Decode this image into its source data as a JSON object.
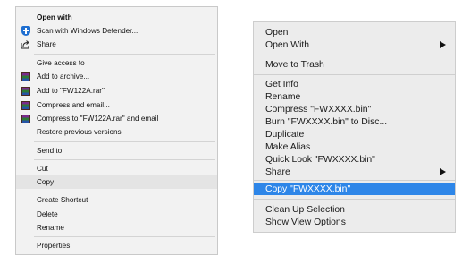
{
  "windows_menu": {
    "items": [
      {
        "label": "Open with",
        "bold": true
      },
      {
        "label": "Scan with Windows Defender...",
        "icon": "shield-icon"
      },
      {
        "label": "Share",
        "icon": "share-icon"
      },
      {
        "label": "Give access to"
      },
      {
        "label": "Add to archive...",
        "icon": "winrar-icon"
      },
      {
        "label": "Add to \"FW122A.rar\"",
        "icon": "winrar-icon"
      },
      {
        "label": "Compress and email...",
        "icon": "winrar-icon"
      },
      {
        "label": "Compress to \"FW122A.rar\" and email",
        "icon": "winrar-icon"
      },
      {
        "label": "Restore previous versions"
      },
      {
        "label": "Send to"
      },
      {
        "label": "Cut"
      },
      {
        "label": "Copy",
        "highlighted": true
      },
      {
        "label": "Create Shortcut"
      },
      {
        "label": "Delete"
      },
      {
        "label": "Rename"
      },
      {
        "label": "Properties"
      }
    ]
  },
  "mac_menu": {
    "items": [
      {
        "label": "Open"
      },
      {
        "label": "Open With",
        "submenu": true
      },
      {
        "label": "Move to Trash"
      },
      {
        "label": "Get Info"
      },
      {
        "label": "Rename"
      },
      {
        "label": "Compress \"FWXXXX.bin\""
      },
      {
        "label": "Burn \"FWXXXX.bin\" to Disc..."
      },
      {
        "label": "Duplicate"
      },
      {
        "label": "Make Alias"
      },
      {
        "label": "Quick Look \"FWXXXX.bin\""
      },
      {
        "label": "Share",
        "submenu": true
      },
      {
        "label": "Copy \"FWXXXX.bin\"",
        "selected": true
      },
      {
        "label": "Clean Up Selection"
      },
      {
        "label": "Show View Options"
      }
    ],
    "selection_color": "#2e86e8"
  }
}
